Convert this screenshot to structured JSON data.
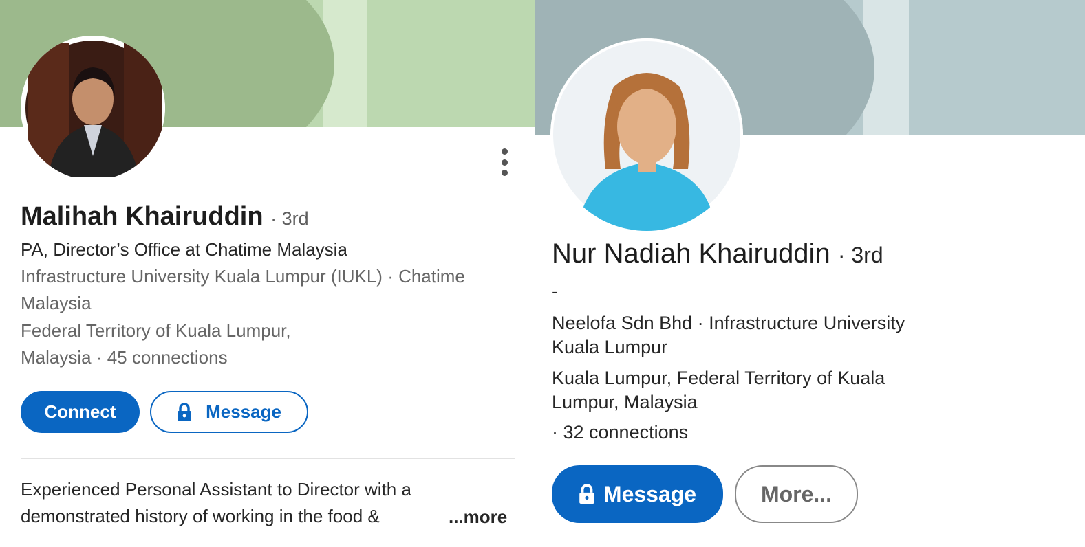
{
  "colors": {
    "left_banner_dark": "#9cb98c",
    "left_banner_light": "#bcd8b0",
    "left_banner_stripe": "#d6e9cd",
    "right_banner_dark": "#9fb3b6",
    "right_banner_light": "#b6cacd",
    "right_banner_stripe": "#d9e5e6",
    "brand_blue": "#0a66c2"
  },
  "left_profile": {
    "name": "Malihah Khairuddin",
    "degree": "· 3rd",
    "headline": "PA, Director’s Office at Chatime Malaysia",
    "org_line_1": "Infrastructure University Kuala Lumpur (IUKL) · Chatime",
    "org_line_2": "Malaysia",
    "location_line_1": "Federal Territory of Kuala Lumpur,",
    "location_line_2": "Malaysia · 45 connections",
    "connect_label": "Connect",
    "message_label": "Message",
    "about_line_1": "Experienced Personal Assistant to Director with a",
    "about_line_2": "demonstrated history of working in the food &",
    "more_label": "...more",
    "menu_icon": "more-vertical-icon",
    "lock_icon": "lock-icon"
  },
  "right_profile": {
    "name": "Nur Nadiah Khairuddin",
    "degree": "· 3rd",
    "headline": "-",
    "org_line_1": "Neelofa Sdn Bhd · Infrastructure University",
    "org_line_2": "Kuala Lumpur",
    "location_line_1": "Kuala Lumpur, Federal Territory of Kuala",
    "location_line_2": "Lumpur, Malaysia",
    "connections": "· 32 connections",
    "message_label": "Message",
    "more_button_label": "More...",
    "lock_icon": "lock-icon"
  }
}
